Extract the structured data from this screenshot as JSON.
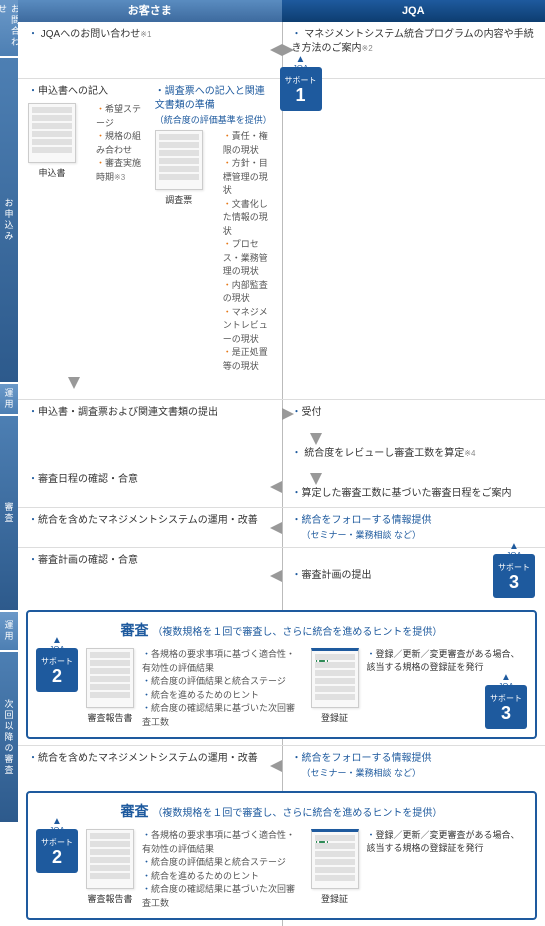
{
  "headers": {
    "customer": "お客さま",
    "jqa": "JQA"
  },
  "side": {
    "inquiry": "お問合わせ",
    "apply": "お申込み",
    "operate1": "運用",
    "audit1": "審査",
    "operate2": "運用",
    "later": "次回以降の審査"
  },
  "support": {
    "label_prefix": "JQAの",
    "label": "サポート",
    "n1": "1",
    "n2": "2",
    "n3": "3"
  },
  "inquiry": {
    "c": "JQAへのお問い合わせ",
    "c_note": "※1",
    "j": "マネジメントシステム統合プログラムの内容や手続き方法のご案内",
    "j_note": "※2"
  },
  "apply": {
    "fill": "申込書への記入",
    "survey_title": "調査票への記入と関連文書類の準備",
    "survey_sub": "（統合度の評価基準を提供）",
    "form_opts": [
      "希望ステージ",
      "規格の組み合わせ",
      "審査実施時期"
    ],
    "form_opts_note": "※3",
    "survey_opts": [
      "責任・権限の現状",
      "方針・目標管理の現状",
      "文書化した情報の現状",
      "プロセス・業務管理の現状",
      "内部監査の現状",
      "マネジメントレビューの現状",
      "是正処置等の現状"
    ],
    "doc_form": "申込書",
    "doc_survey": "調査票",
    "submit": "申込書・調査票および関連文書類の提出",
    "receive": "受付",
    "review": "統合度をレビューし審査工数を算定",
    "review_note": "※4",
    "schedule_j": "算定した審査工数に基づいた審査日程をご案内",
    "schedule_c": "審査日程の確認・合意"
  },
  "operate": {
    "c": "統合を含めたマネジメントシステムの運用・改善",
    "j": "統合をフォローする情報提供",
    "j_sub": "（セミナー・業務相談 など）"
  },
  "plan": {
    "c": "審査計画の確認・合意",
    "j": "審査計画の提出"
  },
  "audit": {
    "title": "審査",
    "subtitle": "（複数規格を１回で審査し、さらに統合を進めるヒントを提供）",
    "points": [
      "各規格の要求事項に基づく適合性・有効性の評価結果",
      "統合度の評価結果と統合ステージ",
      "統合を進めるためのヒント",
      "統合度の確認結果に基づいた次回審査工数"
    ],
    "doc_report": "審査報告書",
    "doc_cert": "登録証",
    "cert_text": "登録／更新／変更審査がある場合、該当する規格の登録証を発行"
  }
}
